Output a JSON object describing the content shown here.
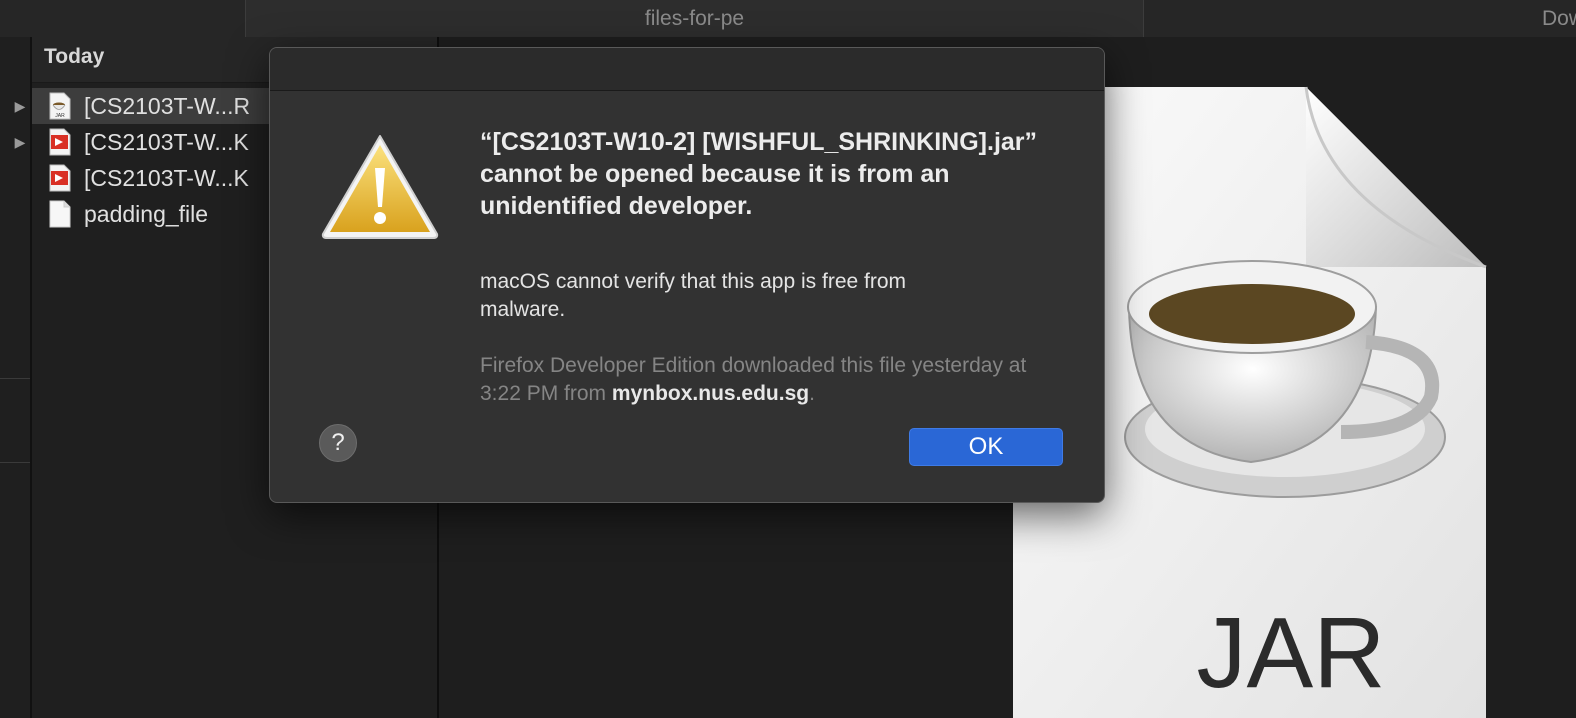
{
  "tabs": {
    "left_label": "",
    "middle_label": "files-for-pe",
    "right_label": "Dow"
  },
  "column": {
    "header": "Today",
    "files": [
      {
        "name": "[CS2103T-W...R",
        "type": "jar",
        "expandable": true,
        "selected": true
      },
      {
        "name": "[CS2103T-W...K",
        "type": "pdf",
        "expandable": true,
        "selected": false
      },
      {
        "name": "[CS2103T-W...K",
        "type": "pdf",
        "expandable": false,
        "selected": false
      },
      {
        "name": "padding_file",
        "type": "document",
        "expandable": false,
        "selected": false
      }
    ]
  },
  "preview": {
    "icon": "jar-coffee-cup-icon",
    "label": "JAR"
  },
  "dialog": {
    "icon": "warning-triangle-icon",
    "headline": "“[CS2103T-W10-2] [WISHFUL_SHRINKING].jar” cannot be opened because it is from an unidentified developer.",
    "body": "macOS cannot verify that this app is free from malware.",
    "source_prefix": "Firefox Developer Edition downloaded this file yesterday at 3:22 PM from ",
    "source_domain": "mynbox.nus.edu.sg",
    "source_suffix": ".",
    "help_label": "?",
    "ok_label": "OK"
  },
  "colors": {
    "accent": "#2a67d6",
    "warning": "#f0c040",
    "background": "#1e1e1e"
  }
}
